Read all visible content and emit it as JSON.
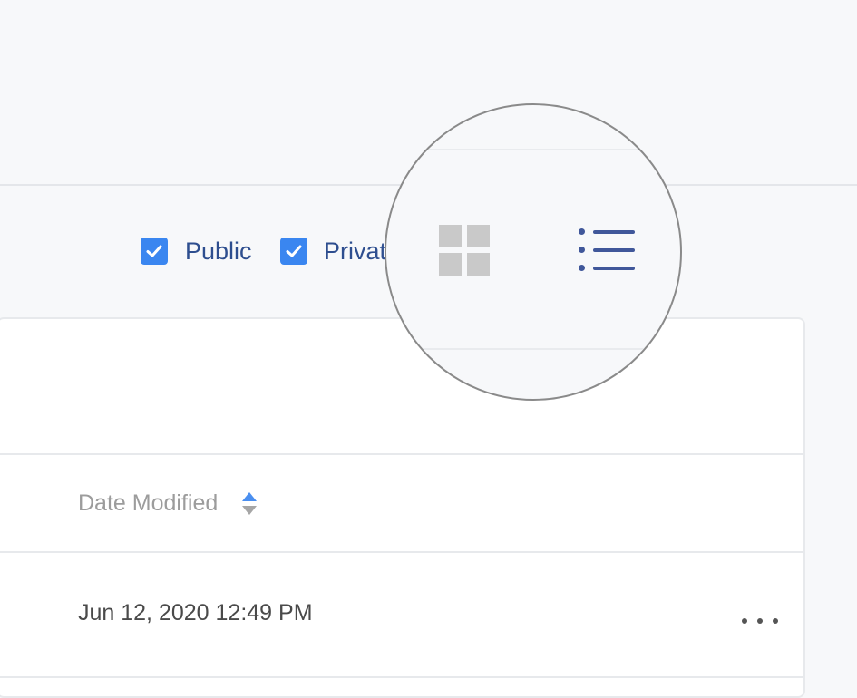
{
  "filters": {
    "public_label": "Public",
    "public_checked": true,
    "private_label": "Privat",
    "private_checked": true
  },
  "view_toggle": {
    "grid_icon": "grid-view-icon",
    "list_icon": "list-view-icon",
    "active": "list"
  },
  "table": {
    "columns": [
      {
        "label": "Date Modified",
        "sort_icon": "sort-icon"
      }
    ],
    "rows": [
      {
        "date_modified": "Jun 12, 2020 12:49 PM",
        "actions_icon": "more-icon"
      }
    ]
  },
  "colors": {
    "checkbox": "#3a86f0",
    "label": "#2e4e8f",
    "list_icon": "#40579a",
    "grid_icon_inactive": "#c9c9c9"
  }
}
